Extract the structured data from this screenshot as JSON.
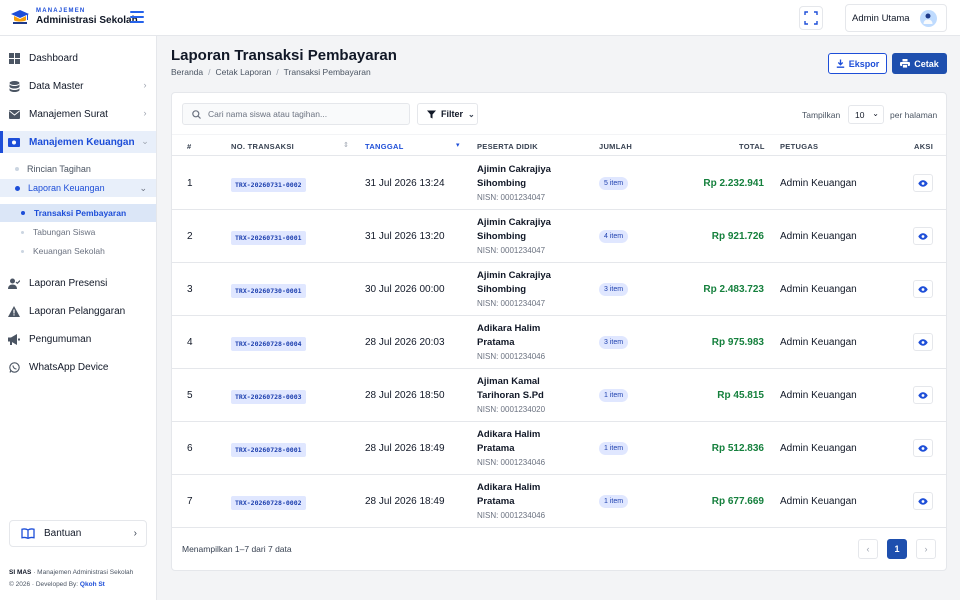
{
  "app": {
    "brand_small": "MANAJEMEN",
    "brand_name": "Administrasi Sekolah",
    "user_name": "Admin Utama"
  },
  "sidebar": {
    "items": [
      {
        "label": "Dashboard",
        "icon": "grid-icon"
      },
      {
        "label": "Data Master",
        "icon": "database-icon"
      },
      {
        "label": "Manajemen Surat",
        "icon": "mail-icon"
      },
      {
        "label": "Manajemen Keuangan",
        "icon": "money-icon"
      },
      {
        "label": "Laporan Presensi",
        "icon": "user-check-icon"
      },
      {
        "label": "Laporan Pelanggaran",
        "icon": "warning-icon"
      },
      {
        "label": "Pengumuman",
        "icon": "megaphone-icon"
      },
      {
        "label": "WhatsApp Device",
        "icon": "whatsapp-icon"
      }
    ],
    "keuangan_sub": [
      {
        "label": "Rincian Tagihan"
      },
      {
        "label": "Laporan Keuangan"
      }
    ],
    "laporan_sub": [
      {
        "label": "Transaksi Pembayaran"
      },
      {
        "label": "Tabungan Siswa"
      },
      {
        "label": "Keuangan Sekolah"
      }
    ],
    "help_label": "Bantuan",
    "footer_app": "SI MAS",
    "footer_desc": " · Manajemen Administrasi Sekolah",
    "footer_copy": "© 2026 · Developed By: ",
    "footer_dev": "Qkoh St"
  },
  "page": {
    "title": "Laporan Transaksi Pembayaran",
    "breadcrumb": [
      "Beranda",
      "Cetak Laporan",
      "Transaksi Pembayaran"
    ],
    "breadcrumb_sep": "/",
    "export_label": "Ekspor",
    "print_label": "Cetak"
  },
  "toolbar": {
    "search_placeholder": "Cari nama siswa atau tagihan...",
    "filter_label": "Filter",
    "show_label": "Tampilkan",
    "page_size": "10",
    "per_page_label": "per halaman"
  },
  "table": {
    "headers": {
      "num": "#",
      "trx": "NO. TRANSAKSI",
      "date": "TANGGAL",
      "student": "PESERTA DIDIK",
      "qty": "JUMLAH",
      "total": "TOTAL",
      "officer": "PETUGAS",
      "action": "AKSI"
    },
    "rows": [
      {
        "num": "1",
        "trx": "TRX-20260731-0002",
        "date": "31 Jul 2026 13:24",
        "name1": "Ajimin Cakrajiya",
        "name2": "Sihombing",
        "nisn": "NISN: 0001234047",
        "qty": "5 item",
        "total": "Rp 2.232.941",
        "officer": "Admin Keuangan"
      },
      {
        "num": "2",
        "trx": "TRX-20260731-0001",
        "date": "31 Jul 2026 13:20",
        "name1": "Ajimin Cakrajiya",
        "name2": "Sihombing",
        "nisn": "NISN: 0001234047",
        "qty": "4 item",
        "total": "Rp 921.726",
        "officer": "Admin Keuangan"
      },
      {
        "num": "3",
        "trx": "TRX-20260730-0001",
        "date": "30 Jul 2026 00:00",
        "name1": "Ajimin Cakrajiya",
        "name2": "Sihombing",
        "nisn": "NISN: 0001234047",
        "qty": "3 item",
        "total": "Rp 2.483.723",
        "officer": "Admin Keuangan"
      },
      {
        "num": "4",
        "trx": "TRX-20260728-0004",
        "date": "28 Jul 2026 20:03",
        "name1": "Adikara Halim",
        "name2": "Pratama",
        "nisn": "NISN: 0001234046",
        "qty": "3 item",
        "total": "Rp 975.983",
        "officer": "Admin Keuangan"
      },
      {
        "num": "5",
        "trx": "TRX-20260728-0003",
        "date": "28 Jul 2026 18:50",
        "name1": "Ajiman Kamal",
        "name2": "Tarihoran S.Pd",
        "nisn": "NISN: 0001234020",
        "qty": "1 item",
        "total": "Rp 45.815",
        "officer": "Admin Keuangan"
      },
      {
        "num": "6",
        "trx": "TRX-20260728-0001",
        "date": "28 Jul 2026 18:49",
        "name1": "Adikara Halim",
        "name2": "Pratama",
        "nisn": "NISN: 0001234046",
        "qty": "1 item",
        "total": "Rp 512.836",
        "officer": "Admin Keuangan"
      },
      {
        "num": "7",
        "trx": "TRX-20260728-0002",
        "date": "28 Jul 2026 18:49",
        "name1": "Adikara Halim",
        "name2": "Pratama",
        "nisn": "NISN: 0001234046",
        "qty": "1 item",
        "total": "Rp 677.669",
        "officer": "Admin Keuangan"
      }
    ]
  },
  "pagination": {
    "summary": "Menampilkan 1–7 dari 7 data",
    "prev": "‹",
    "current": "1",
    "next": "›"
  },
  "colors": {
    "primary": "#1e4fae",
    "accent": "#1d4ed8",
    "amount": "#15803d"
  }
}
